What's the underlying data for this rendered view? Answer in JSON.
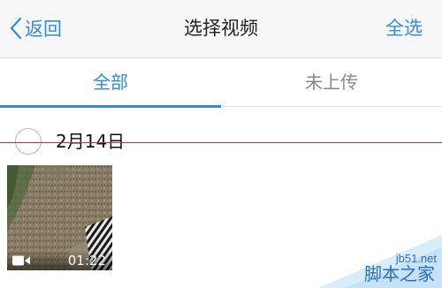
{
  "navbar": {
    "back_label": "返回",
    "title": "选择视频",
    "select_all_label": "全选",
    "accent_color": "#2f8ce0"
  },
  "tabs": [
    {
      "label": "全部",
      "active": true
    },
    {
      "label": "未上传",
      "active": false
    }
  ],
  "groups": [
    {
      "date": "2月14日",
      "selected": false,
      "videos": [
        {
          "duration": "01:22",
          "icon": "video-camera-icon"
        }
      ]
    }
  ],
  "watermark": {
    "site": "jb51.net",
    "name": "脚本之家"
  }
}
